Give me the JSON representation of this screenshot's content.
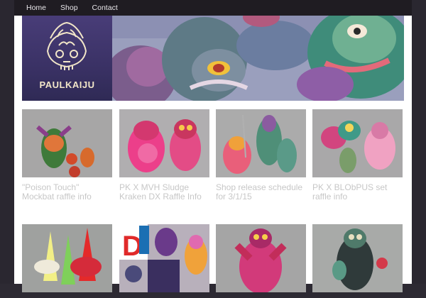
{
  "nav": {
    "items": [
      {
        "label": "Home"
      },
      {
        "label": "Shop"
      },
      {
        "label": "Contact"
      }
    ]
  },
  "banner": {
    "logo_text": "PAULKAIJU"
  },
  "posts": [
    {
      "title": "\"Poison Touch\" Mockbat raffle info"
    },
    {
      "title": "PK X MVH Sludge Kraken DX Raffle Info"
    },
    {
      "title": "Shop release schedule for 3/1/15"
    },
    {
      "title": "PK X BLObPUS set raffle info"
    },
    {
      "title": ""
    },
    {
      "title": ""
    },
    {
      "title": ""
    },
    {
      "title": ""
    }
  ],
  "colors": {
    "background": "#2d2a33",
    "nav_bg": "#1f1c22",
    "caption_text": "#c7c7c7",
    "logo_purple": "#3b3266"
  }
}
